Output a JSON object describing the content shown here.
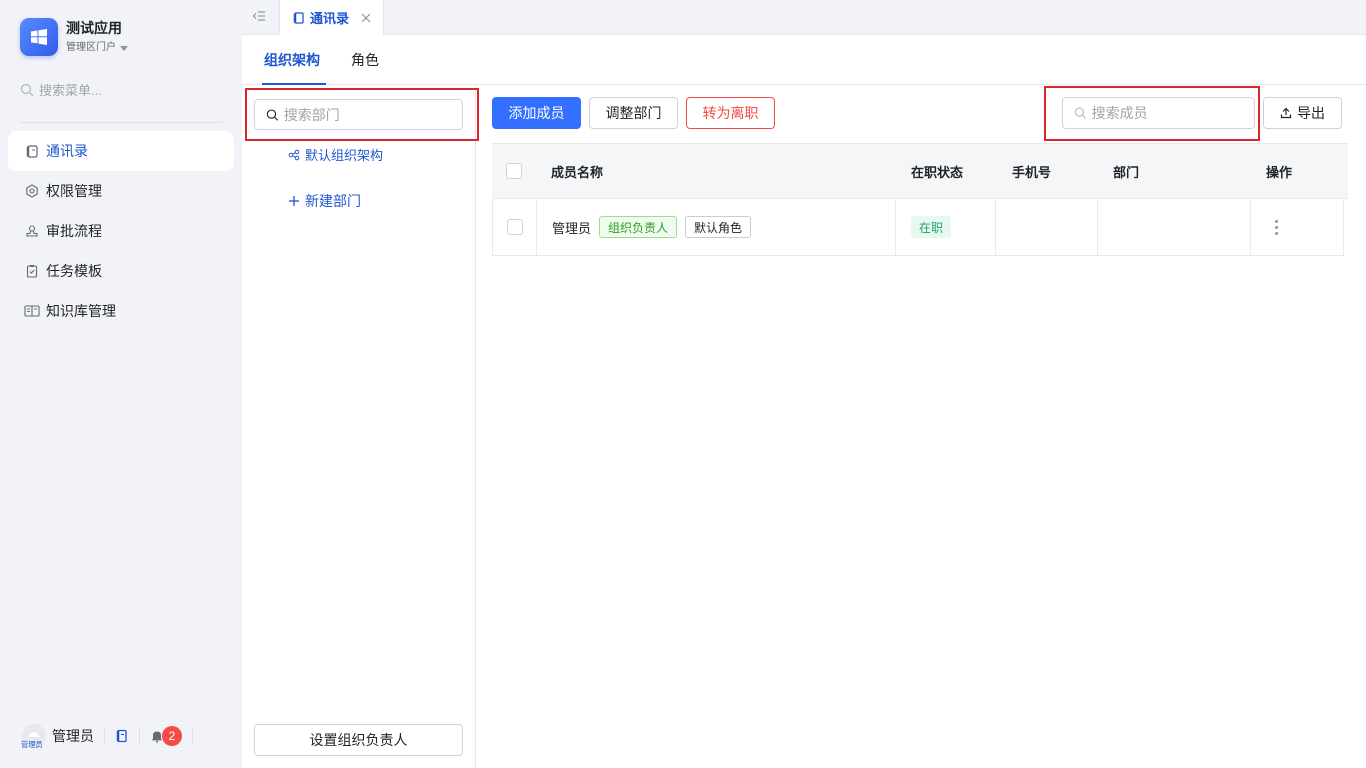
{
  "app": {
    "name": "测试应用",
    "portal": "管理区门户"
  },
  "sidebar": {
    "search_placeholder": "搜索菜单...",
    "items": [
      {
        "label": "通讯录",
        "icon": "contacts-book-icon",
        "active": true
      },
      {
        "label": "权限管理",
        "icon": "gear-icon",
        "active": false
      },
      {
        "label": "审批流程",
        "icon": "user-stamp-icon",
        "active": false
      },
      {
        "label": "任务模板",
        "icon": "clipboard-check-icon",
        "active": false
      },
      {
        "label": "知识库管理",
        "icon": "book-open-icon",
        "active": false
      }
    ],
    "footer": {
      "avatar_text": "管理员",
      "user_name": "管理员",
      "notification_count": "2"
    }
  },
  "tabs": {
    "open_tab": "通讯录"
  },
  "subtabs": [
    {
      "label": "组织架构",
      "active": true
    },
    {
      "label": "角色",
      "active": false
    }
  ],
  "dept_panel": {
    "search_placeholder": "搜索部门",
    "tree_root": "默认组织架构",
    "new_dept": "新建部门",
    "set_leader": "设置组织负责人"
  },
  "toolbar": {
    "add_member": "添加成员",
    "adjust_dept": "调整部门",
    "to_resigned": "转为离职",
    "member_search_placeholder": "搜索成员",
    "export": "导出"
  },
  "table": {
    "columns": [
      "成员名称",
      "在职状态",
      "手机号",
      "部门",
      "操作"
    ],
    "rows": [
      {
        "name": "管理员",
        "tags": [
          "组织负责人",
          "默认角色"
        ],
        "status": "在职",
        "phone": "",
        "dept": ""
      }
    ]
  },
  "colors": {
    "primary": "#3370ff",
    "active_text": "#1f57d1",
    "danger": "#f54a45",
    "highlight_box": "#d9262a"
  }
}
